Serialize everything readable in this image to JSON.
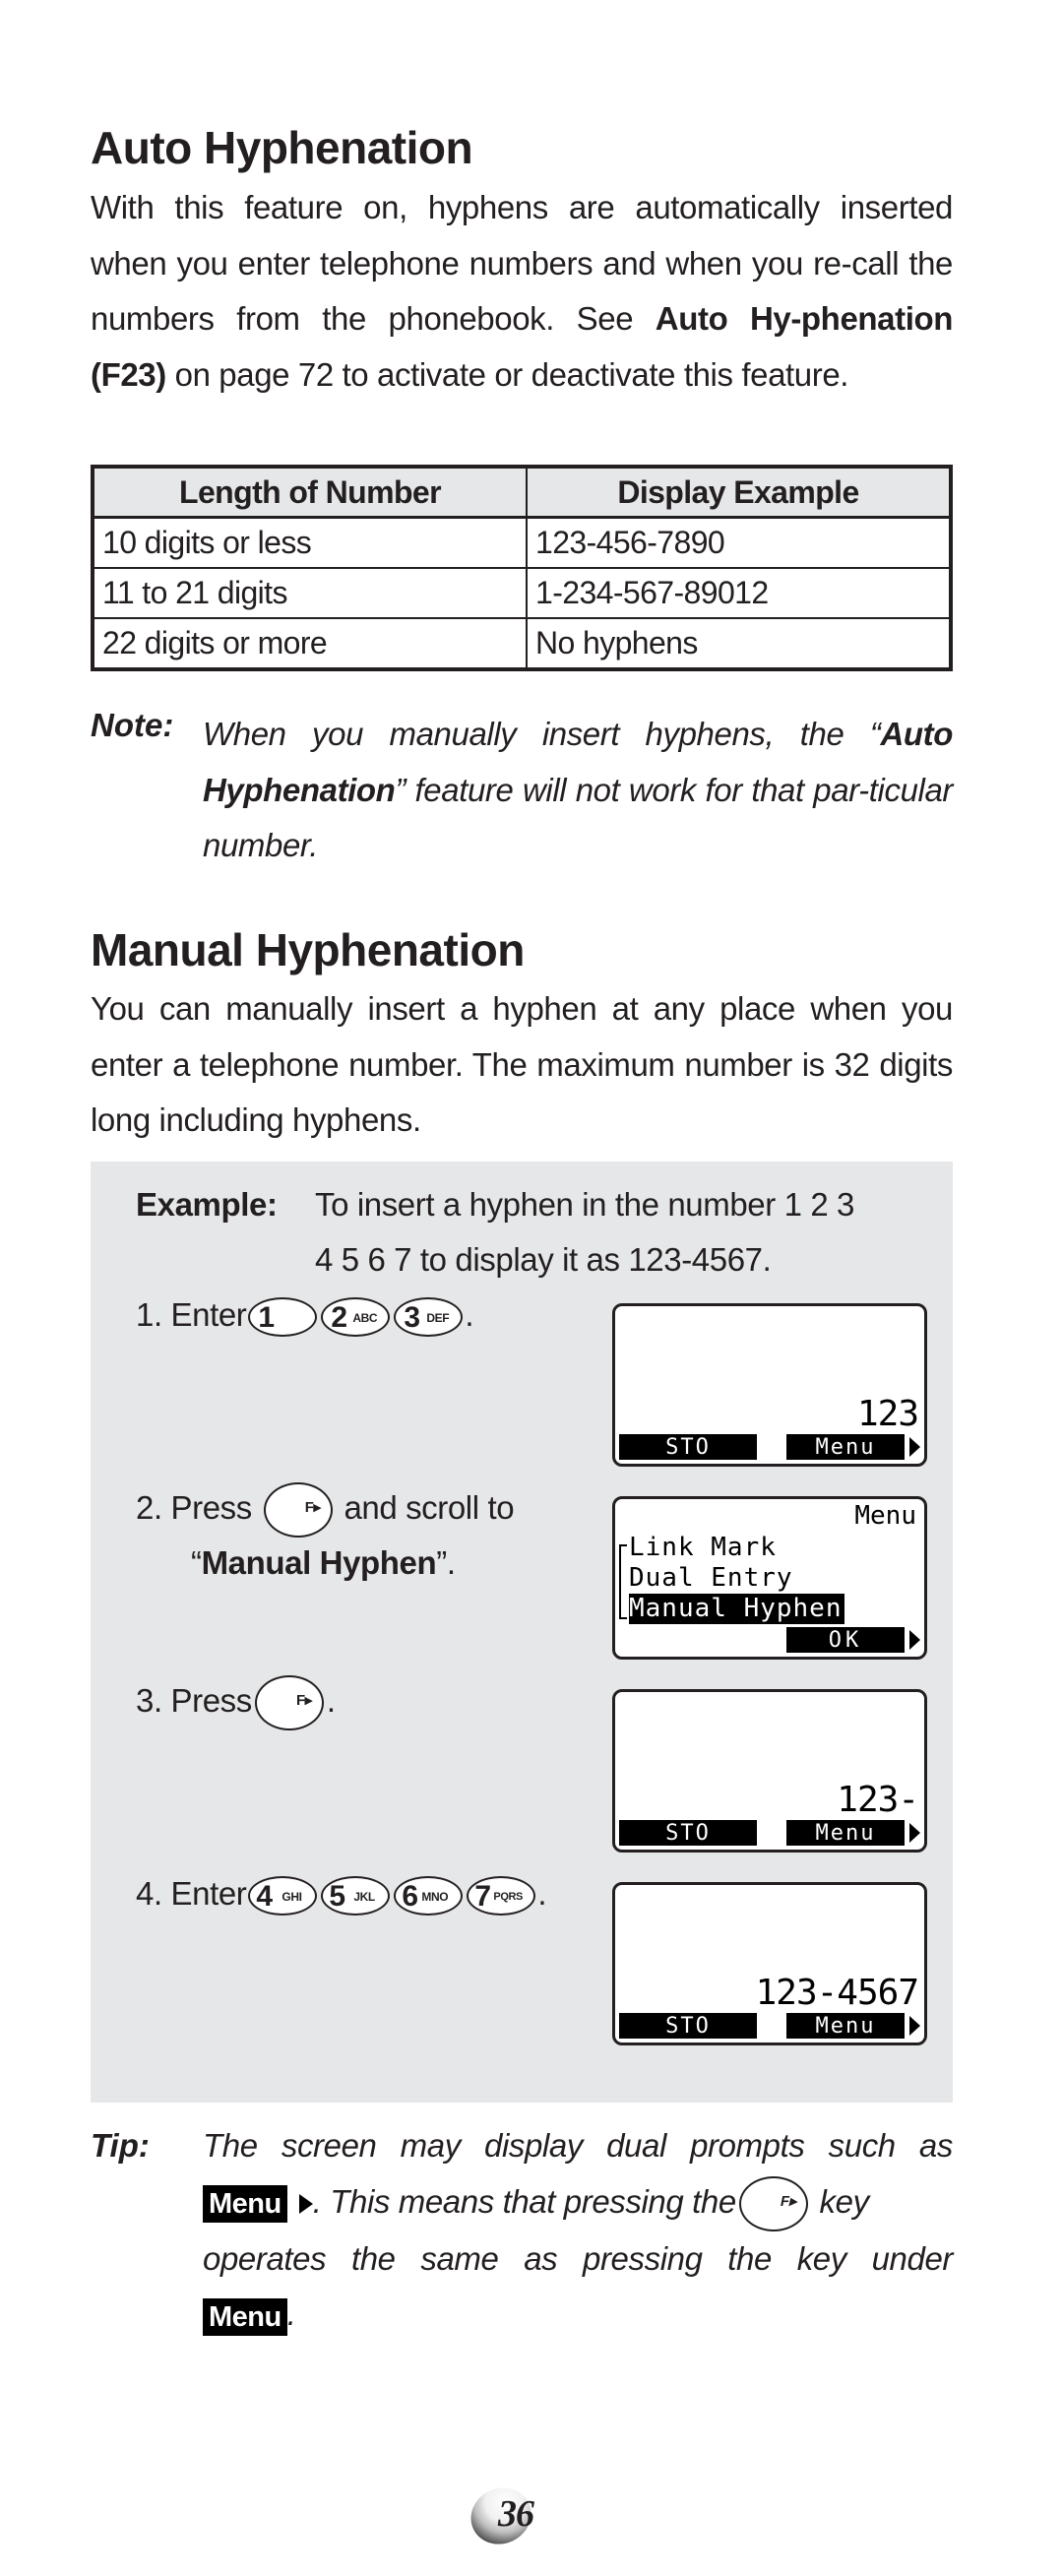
{
  "auto_section": {
    "heading": "Auto Hyphenation",
    "para_part1": "With this feature on, hyphens are automatically inserted when you enter telephone numbers and when you re-call the numbers from the phonebook. See ",
    "para_bold": "Auto Hy-phenation (F23)",
    "para_part2": " on page 72 to activate or deactivate this feature.",
    "table": {
      "headers": [
        "Length of Number",
        "Display Example"
      ],
      "rows": [
        [
          "10 digits or less",
          "123-456-7890"
        ],
        [
          "11 to 21 digits",
          "1-234-567-89012"
        ],
        [
          "22 digits or more",
          "No hyphens"
        ]
      ]
    },
    "note": {
      "label": "Note:",
      "part1": "When you manually insert hyphens, the “",
      "bold": "Auto Hyphenation",
      "part2": "” feature will not work for that par-ticular number."
    }
  },
  "manual_section": {
    "heading": "Manual Hyphenation",
    "para": "You can manually insert a hyphen at any place when you enter a telephone number. The maximum number is 32 digits long including hyphens.",
    "example": {
      "label": "Example:",
      "line1": "To insert a hyphen in the number 1 2 3",
      "line2": "4 5 6 7 to display it as 123-4567."
    },
    "steps": [
      {
        "num": "1.",
        "text_before": "Enter",
        "keys": [
          {
            "num": "1",
            "letters": ""
          },
          {
            "num": "2",
            "letters": "ABC"
          },
          {
            "num": "3",
            "letters": "DEF"
          }
        ],
        "text_after": ".",
        "screen": {
          "digits": "123",
          "soft_left": "STO",
          "soft_right": "Menu"
        }
      },
      {
        "num": "2.",
        "text_before": "Press",
        "key_glyph": "F▸",
        "text_middle": "and scroll to",
        "quote_open": "“",
        "bold": "Manual Hyphen",
        "quote_close": "”.",
        "screen": {
          "title": "Menu",
          "items": [
            "Link Mark",
            "Dual Entry",
            "Manual Hyphen"
          ],
          "selected_index": 2,
          "soft_right": "OK"
        }
      },
      {
        "num": "3.",
        "text_before": "Press",
        "key_glyph": "F▸",
        "text_after": ".",
        "screen": {
          "digits": "123-",
          "soft_left": "STO",
          "soft_right": "Menu"
        }
      },
      {
        "num": "4.",
        "text_before": "Enter",
        "keys": [
          {
            "num": "4",
            "letters": "GHI"
          },
          {
            "num": "5",
            "letters": "JKL"
          },
          {
            "num": "6",
            "letters": "MNO"
          },
          {
            "num": "7",
            "letters": "PQRS"
          }
        ],
        "text_after": ".",
        "screen": {
          "digits": "123-4567",
          "soft_left": "STO",
          "soft_right": "Menu"
        }
      }
    ],
    "tip": {
      "label": "Tip:",
      "line1": "The screen may display dual prompts such as",
      "chip": "Menu",
      "part2": ". This means that pressing the",
      "key_glyph": "F▸",
      "part3": "key operates the same as pressing the key under",
      "chip2": "Menu",
      "end": "."
    }
  },
  "footer": {
    "page_number": "36"
  },
  "colors": {
    "text": "#231f20",
    "example_bg": "#e6e7e8",
    "table_header_bg": "#e6e7e8",
    "lcd_inverse": "#000000"
  }
}
